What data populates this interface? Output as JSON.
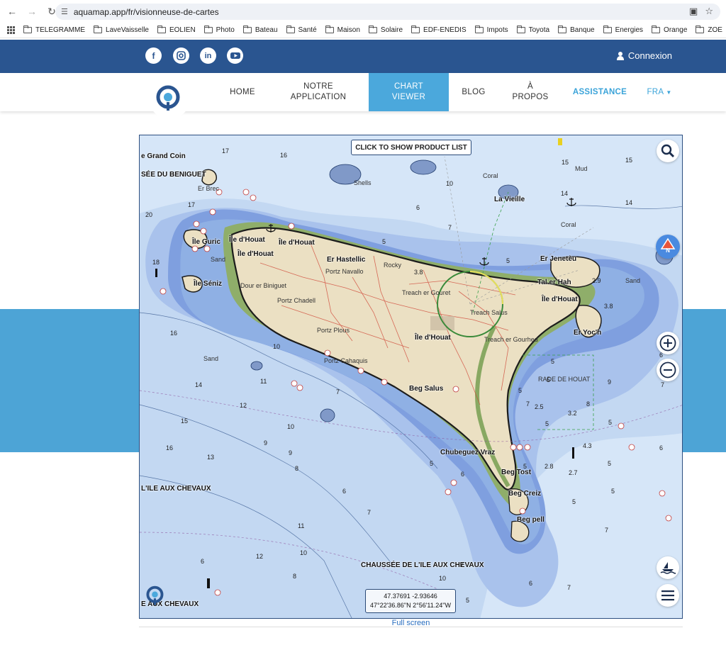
{
  "browser": {
    "url": "aquamap.app/fr/visionneuse-de-cartes",
    "bookmarks": [
      "TELEGRAMME",
      "LaveVaisselle",
      "EOLIEN",
      "Photo",
      "Bateau",
      "Santé",
      "Maison",
      "Solaire",
      "EDF-ENEDIS",
      "Impots",
      "Toyota",
      "Banque",
      "Energies",
      "Orange",
      "ZOE"
    ]
  },
  "header": {
    "social": [
      "f",
      "ig",
      "in",
      "yt"
    ],
    "login_label": "Connexion",
    "logo_text": "Aqua Map"
  },
  "nav": {
    "home": "HOME",
    "app_line1": "NOTRE",
    "app_line2": "APPLICATION",
    "chart_line1": "CHART",
    "chart_line2": "VIEWER",
    "blog": "BLOG",
    "about_line1": "À",
    "about_line2": "PROPOS",
    "assist": "ASSISTANCE",
    "lang": "FRA"
  },
  "map": {
    "product_button": "CLICK TO SHOW PRODUCT LIST",
    "north_label": "N",
    "coords_decimal": "47.37691 -2.93646",
    "coords_dms": "47°22'36.86\"N 2°56'11.24\"W",
    "fullscreen_label": "Full screen",
    "labels": [
      {
        "t": "e Grand Coin"
      },
      {
        "t": "SÉE DU BENIGUET"
      },
      {
        "t": "Er Brec"
      },
      {
        "t": "Île Guric"
      },
      {
        "t": "Île d'Houat"
      },
      {
        "t": "Île d'Houat"
      },
      {
        "t": "Île d'Houat"
      },
      {
        "t": "Er Hastellic"
      },
      {
        "t": "Portz Navallo"
      },
      {
        "t": "Île Séniz"
      },
      {
        "t": "Dour er Biniguet"
      },
      {
        "t": "Portz Chadell"
      },
      {
        "t": "Portz Plous"
      },
      {
        "t": "Portz Cahaquis"
      },
      {
        "t": "Île d'Houat"
      },
      {
        "t": "Treach er Gouret"
      },
      {
        "t": "Treach Salus"
      },
      {
        "t": "Treach er Gourhed"
      },
      {
        "t": "Beg Salus"
      },
      {
        "t": "La Vieille"
      },
      {
        "t": "Er Jenetèu"
      },
      {
        "t": "Tal er Hah"
      },
      {
        "t": "Île d'Houat"
      },
      {
        "t": "Er Yoc'h"
      },
      {
        "t": "RADE DE HOUAT"
      },
      {
        "t": "Chubeguez Vraz"
      },
      {
        "t": "Beg Tost"
      },
      {
        "t": "Beg Creiz"
      },
      {
        "t": "Beg pell"
      },
      {
        "t": "L'ILE AUX CHEVAUX"
      },
      {
        "t": "CHAUSSÉE DE L'ILE AUX CHEVAUX"
      },
      {
        "t": "E AUX CHEVAUX"
      },
      {
        "t": "Coral"
      },
      {
        "t": "Coral"
      },
      {
        "t": "Mud"
      },
      {
        "t": "Shells"
      },
      {
        "t": "Rocky"
      },
      {
        "t": "Sand"
      },
      {
        "t": "Sand"
      },
      {
        "t": "Sand"
      }
    ],
    "depths": [
      "17",
      "16",
      "15",
      "15",
      "14",
      "14",
      "10",
      "6",
      "7",
      "5",
      "3.8",
      "5",
      "2.9",
      "3.8",
      "20",
      "17",
      "18",
      "16",
      "10",
      "11",
      "14",
      "12",
      "15",
      "16",
      "13",
      "9",
      "8",
      "9",
      "10",
      "7",
      "6",
      "7",
      "8",
      "10",
      "11",
      "12",
      "10",
      "6",
      "7",
      "7",
      "6",
      "5",
      "5",
      "4.3",
      "2.8",
      "2.7",
      "5",
      "5",
      "5",
      "6",
      "6",
      "7",
      "8",
      "9",
      "7",
      "5",
      "3.2",
      "2.5",
      "5",
      "5",
      "5",
      "5",
      "7",
      "7",
      "6",
      "5"
    ]
  }
}
